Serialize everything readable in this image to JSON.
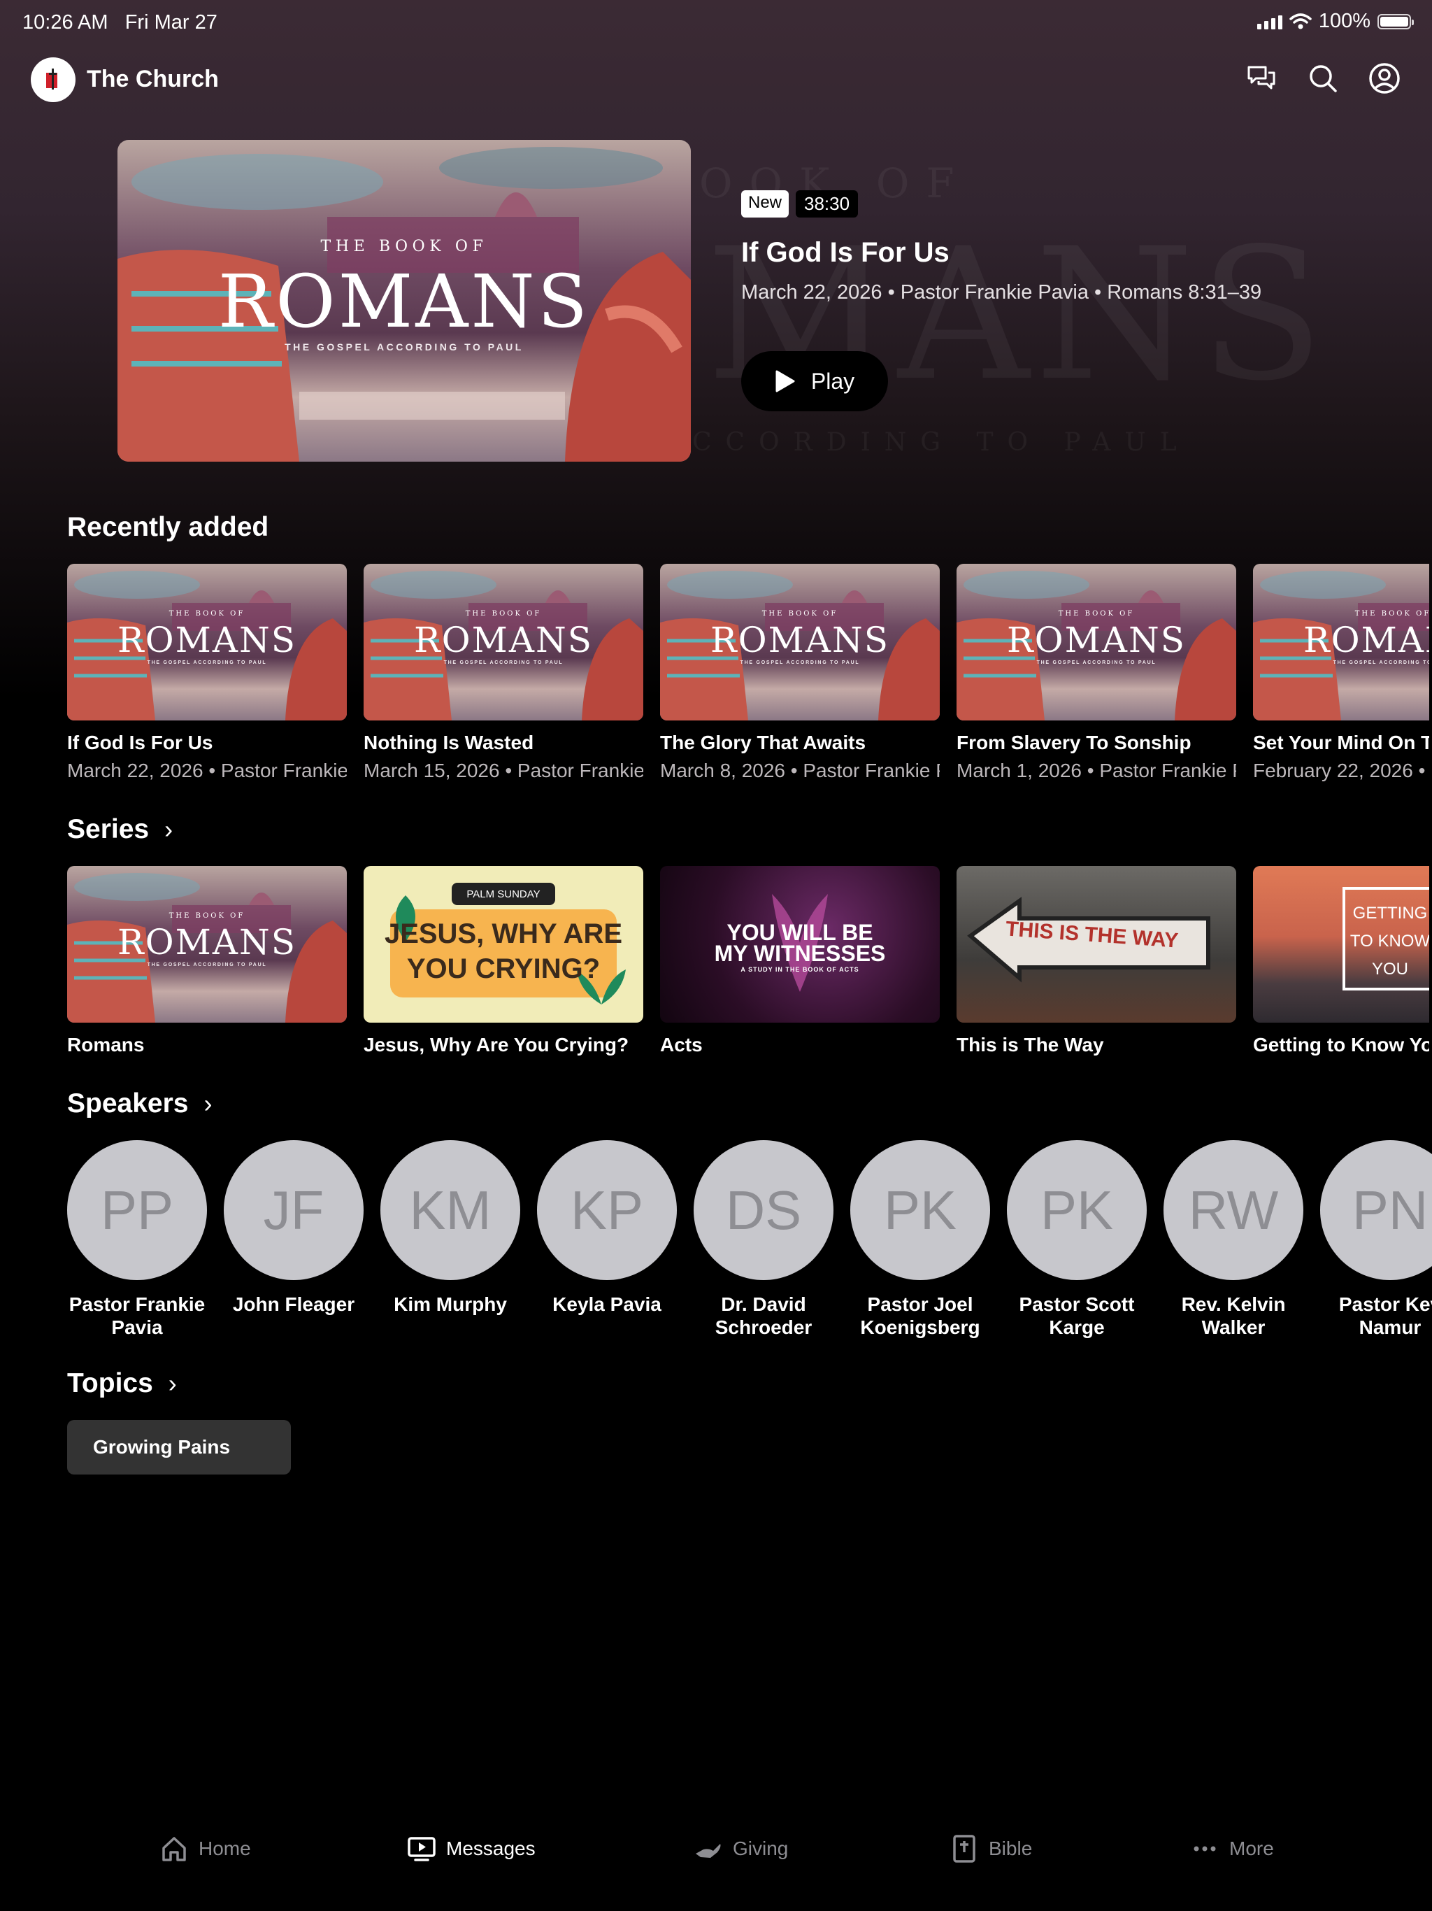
{
  "status_bar": {
    "time": "10:26 AM",
    "date": "Fri Mar 27",
    "battery": "100%"
  },
  "app": {
    "title": "The Church"
  },
  "hero_backdrop": {
    "line1": "OOK OF",
    "line2": "MANS",
    "line3": "CCORDING TO PAUL"
  },
  "art_romans": {
    "small": "THE BOOK OF",
    "big": "ROMANS",
    "sub": "THE GOSPEL ACCORDING TO PAUL"
  },
  "featured": {
    "badge_new": "New",
    "duration": "38:30",
    "title": "If God Is For Us",
    "meta": "March 22, 2026 • Pastor Frankie Pavia • Romans 8:31–39",
    "play_label": "Play"
  },
  "recently_added": {
    "heading": "Recently added",
    "items": [
      {
        "title": "If God Is For Us",
        "meta": "March 22, 2026 • Pastor Frankie Pavia"
      },
      {
        "title": "Nothing Is Wasted",
        "meta": "March 15, 2026 • Pastor Frankie Pavia"
      },
      {
        "title": "The Glory That Awaits",
        "meta": "March 8, 2026 • Pastor Frankie Pavia"
      },
      {
        "title": "From Slavery To Sonship",
        "meta": "March 1, 2026 • Pastor Frankie Pavia"
      },
      {
        "title": "Set Your Mind On T",
        "meta": "February 22, 2026 •"
      }
    ]
  },
  "series": {
    "heading": "Series",
    "items": [
      {
        "title": "Romans"
      },
      {
        "title": "Jesus, Why Are You Crying?",
        "art_tag": "PALM SUNDAY",
        "art_line1": "JESUS, WHY ARE",
        "art_line2": "YOU CRYING?"
      },
      {
        "title": "Acts",
        "art_line1": "YOU WILL BE",
        "art_line2": "MY WITNESSES",
        "art_sub": "A STUDY IN THE BOOK OF ACTS"
      },
      {
        "title": "This is The Way",
        "art_sign": "THIS IS THE WAY"
      },
      {
        "title": "Getting to Know Yo",
        "art_line1": "GETTING",
        "art_line2": "TO KNOW",
        "art_line3": "YOU"
      }
    ]
  },
  "speakers": {
    "heading": "Speakers",
    "items": [
      {
        "initials": "PP",
        "name": "Pastor Frankie Pavia"
      },
      {
        "initials": "JF",
        "name": "John Fleager"
      },
      {
        "initials": "KM",
        "name": "Kim Murphy"
      },
      {
        "initials": "KP",
        "name": "Keyla Pavia"
      },
      {
        "initials": "DS",
        "name": "Dr. David Schroeder"
      },
      {
        "initials": "PK",
        "name": "Pastor Joel Koenigsberg"
      },
      {
        "initials": "PK",
        "name": "Pastor Scott Karge"
      },
      {
        "initials": "RW",
        "name": "Rev. Kelvin Walker"
      },
      {
        "initials": "PN",
        "name": "Pastor Kev Namur"
      }
    ]
  },
  "topics": {
    "heading": "Topics",
    "chip": "Growing Pains"
  },
  "tabs": [
    {
      "label": "Home",
      "icon": "home-icon"
    },
    {
      "label": "Messages",
      "icon": "tv-play-icon"
    },
    {
      "label": "Giving",
      "icon": "giving-hand-icon"
    },
    {
      "label": "Bible",
      "icon": "bible-icon"
    },
    {
      "label": "More",
      "icon": "more-dots-icon"
    }
  ],
  "colors": {
    "background": "#000000",
    "chip": "#333333",
    "avatar": "#c7c7cc",
    "inactive_tab": "#8e8e93"
  }
}
